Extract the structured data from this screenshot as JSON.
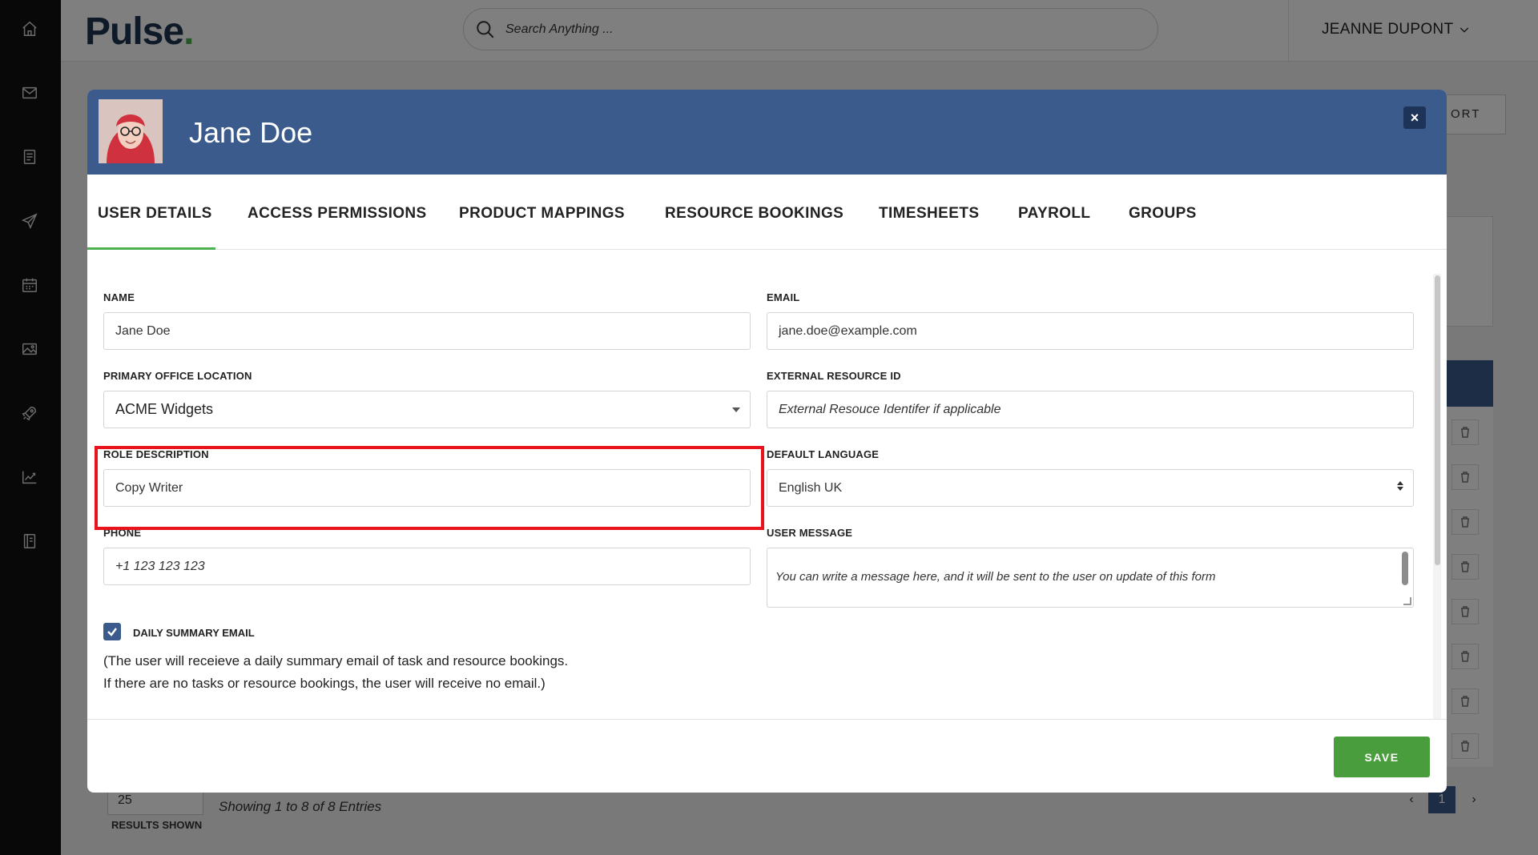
{
  "app": {
    "logo": "Pulse",
    "logo_dot": "."
  },
  "search": {
    "placeholder": "Search Anything ..."
  },
  "user": {
    "name": "JEANNE DUPONT"
  },
  "sidebar": {
    "icons": [
      "home-icon",
      "mail-icon",
      "document-icon",
      "send-icon",
      "calendar-icon",
      "image-icon",
      "rocket-icon",
      "chart-icon",
      "notebook-icon"
    ]
  },
  "background_page": {
    "export_label": "ORT",
    "results_value": "25",
    "results_label": "RESULTS SHOWN",
    "showing_text": "Showing 1 to 8 of 8 Entries",
    "page_number": "1"
  },
  "modal": {
    "title": "Jane Doe",
    "close_label": "×",
    "tabs": [
      {
        "label": "USER DETAILS",
        "active": true
      },
      {
        "label": "ACCESS PERMISSIONS",
        "active": false
      },
      {
        "label": "PRODUCT MAPPINGS",
        "active": false
      },
      {
        "label": "RESOURCE BOOKINGS",
        "active": false
      },
      {
        "label": "TIMESHEETS",
        "active": false
      },
      {
        "label": "PAYROLL",
        "active": false
      },
      {
        "label": "GROUPS",
        "active": false
      }
    ],
    "form": {
      "name": {
        "label": "NAME",
        "value": "Jane Doe"
      },
      "email": {
        "label": "EMAIL",
        "value": "jane.doe@example.com"
      },
      "office": {
        "label": "PRIMARY OFFICE LOCATION",
        "value": "ACME Widgets"
      },
      "external_id": {
        "label": "EXTERNAL RESOURCE ID",
        "placeholder": "External Resouce Identifer if applicable"
      },
      "role": {
        "label": "ROLE DESCRIPTION",
        "value": "Copy Writer"
      },
      "language": {
        "label": "DEFAULT LANGUAGE",
        "value": "English UK"
      },
      "phone": {
        "label": "PHONE",
        "placeholder": "+1 123 123 123"
      },
      "message": {
        "label": "USER MESSAGE",
        "placeholder": "You can write a message here, and it will be sent to the user on update of this form"
      },
      "daily_summary": {
        "label": "DAILY SUMMARY EMAIL",
        "checked": true,
        "note_line1": "(The user will receieve a daily summary email of task and resource bookings.",
        "note_line2": "If there are no tasks or resource bookings, the user will receive no email.)"
      }
    },
    "save_label": "SAVE"
  },
  "colors": {
    "header_blue": "#3b5b8c",
    "accent_green": "#4caf50",
    "save_green": "#4a9d3c",
    "highlight_red": "#e8131b",
    "sidebar_bg": "#111111"
  }
}
